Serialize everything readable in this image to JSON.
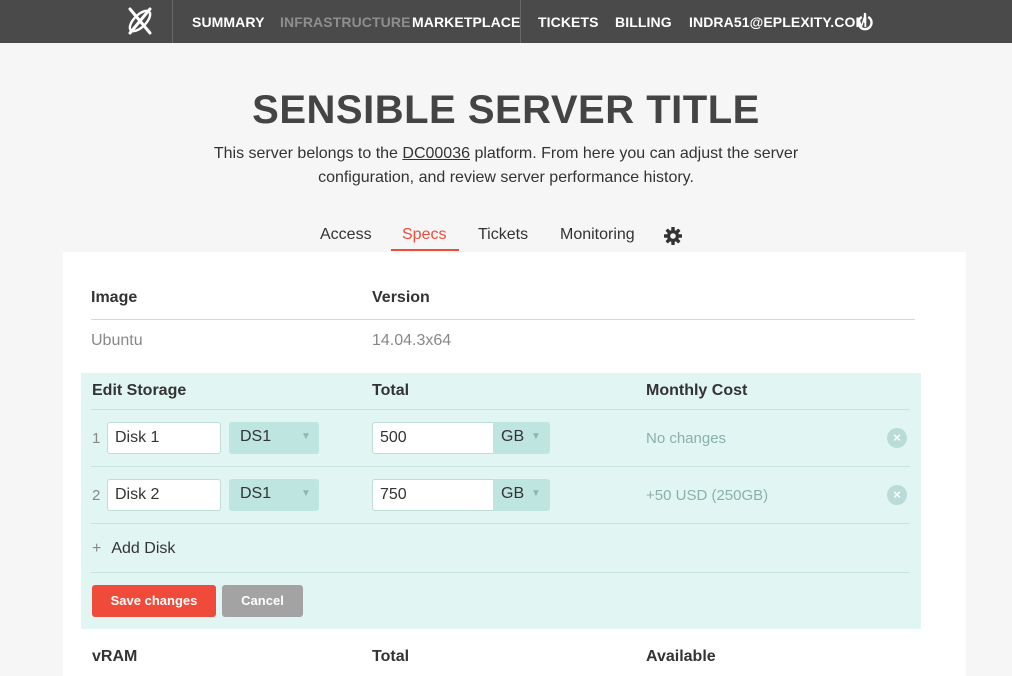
{
  "nav": {
    "items": [
      "SUMMARY",
      "INFRASTRUCTURE",
      "MARKETPLACE",
      "TICKETS",
      "BILLING",
      "INDRA51@EPLEXITY.COM"
    ],
    "logo_icon": "x-logo-icon",
    "power_icon": "power-icon"
  },
  "header": {
    "title": "SENSIBLE SERVER TITLE",
    "desc_before": "This server belongs to the ",
    "desc_link": "DC00036",
    "desc_after": " platform. From here you can adjust the server configuration, and review server performance history."
  },
  "tabs": [
    "Access",
    "Specs",
    "Tickets",
    "Monitoring"
  ],
  "active_tab": "Specs",
  "image_section": {
    "headers": [
      "Image",
      "Version"
    ],
    "values": [
      "Ubuntu",
      "14.04.3x64"
    ]
  },
  "storage": {
    "headers": [
      "Edit Storage",
      "Total",
      "Monthly Cost"
    ],
    "rows": [
      {
        "num": "1",
        "name": "Disk 1",
        "type": "DS1",
        "total": "500",
        "unit": "GB",
        "cost": "No changes"
      },
      {
        "num": "2",
        "name": "Disk 2",
        "type": "DS1",
        "total": "750",
        "unit": "GB",
        "cost": "+50 USD (250GB)"
      }
    ],
    "add_label": "Add Disk",
    "add_symbol": "+",
    "save_label": "Save changes",
    "cancel_label": "Cancel",
    "remove_symbol": "×"
  },
  "vram": {
    "headers": [
      "vRAM",
      "Total",
      "Available"
    ]
  },
  "colors": {
    "accent": "#f04a3a",
    "nav_bg": "#4a4a4a",
    "storage_bg": "#e1f5f3"
  }
}
